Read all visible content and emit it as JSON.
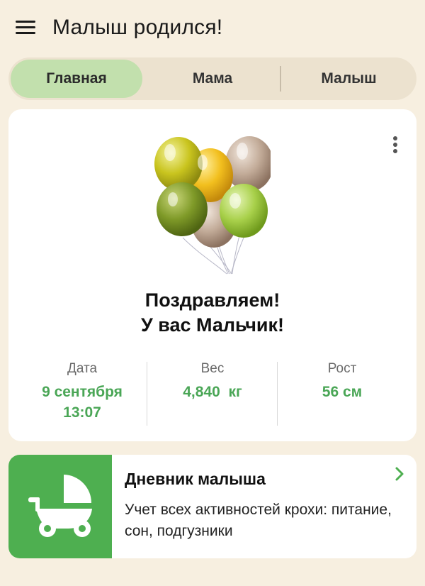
{
  "header": {
    "menu_icon": "hamburger-menu-icon",
    "title": "Малыш родился!"
  },
  "tabs": [
    {
      "label": "Главная",
      "active": true
    },
    {
      "label": "Мама",
      "active": false
    },
    {
      "label": "Малыш",
      "active": false
    }
  ],
  "colors": {
    "background": "#f7efe0",
    "tab_active": "#c2e0ad",
    "accent_green": "#4aa656",
    "diary_icon_bg": "#4eaf50"
  },
  "birth_card": {
    "image": "balloons-illustration",
    "congrats_line1": "Поздравляем!",
    "congrats_line2": "У вас Мальчик!",
    "stats": {
      "date": {
        "label": "Дата",
        "value_line1": "9 сентября",
        "value_line2": "13:07"
      },
      "weight": {
        "label": "Вес",
        "value": "4,840  кг"
      },
      "height": {
        "label": "Рост",
        "value": "56 см"
      }
    }
  },
  "diary": {
    "icon": "baby-stroller-icon",
    "title": "Дневник малыша",
    "description": "Учет всех активностей крохи: питание, сон, подгузники"
  }
}
